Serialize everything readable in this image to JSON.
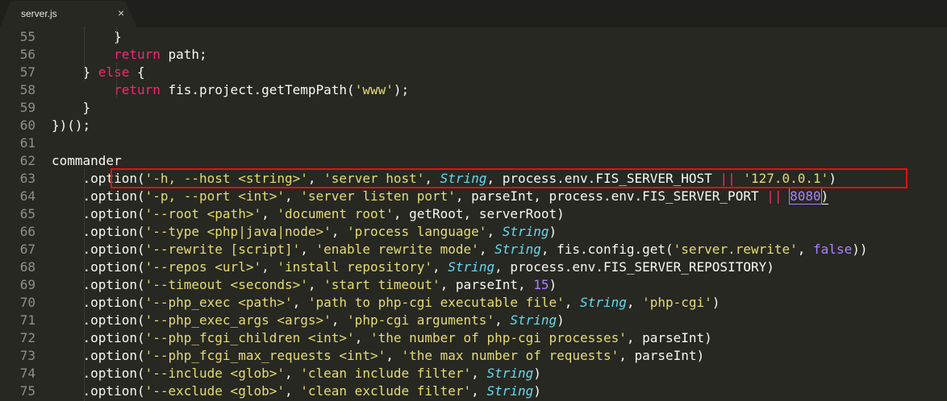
{
  "tab": {
    "filename": "server.js",
    "close_glyph": "×"
  },
  "lines": [
    {
      "no": "55",
      "indent": "        ",
      "tokens": [
        {
          "t": "}",
          "c": ""
        }
      ]
    },
    {
      "no": "56",
      "indent": "        ",
      "tokens": [
        {
          "t": "return",
          "c": "k"
        },
        {
          "t": " path;",
          "c": ""
        }
      ]
    },
    {
      "no": "57",
      "indent": "    ",
      "tokens": [
        {
          "t": "} ",
          "c": ""
        },
        {
          "t": "else",
          "c": "k"
        },
        {
          "t": " {",
          "c": ""
        }
      ]
    },
    {
      "no": "58",
      "indent": "        ",
      "tokens": [
        {
          "t": "return",
          "c": "k"
        },
        {
          "t": " fis.project.getTempPath(",
          "c": ""
        },
        {
          "t": "'www'",
          "c": "s"
        },
        {
          "t": ");",
          "c": ""
        }
      ]
    },
    {
      "no": "59",
      "indent": "    ",
      "tokens": [
        {
          "t": "}",
          "c": ""
        }
      ]
    },
    {
      "no": "60",
      "indent": "",
      "tokens": [
        {
          "t": "})();",
          "c": ""
        }
      ]
    },
    {
      "no": "61",
      "indent": "",
      "tokens": []
    },
    {
      "no": "62",
      "indent": "",
      "tokens": [
        {
          "t": "commander",
          "c": ""
        }
      ]
    },
    {
      "no": "63",
      "indent": "    ",
      "tokens": [
        {
          "t": ".option(",
          "c": ""
        },
        {
          "t": "'-h, --host <string>'",
          "c": "s"
        },
        {
          "t": ", ",
          "c": ""
        },
        {
          "t": "'server host'",
          "c": "s"
        },
        {
          "t": ", ",
          "c": ""
        },
        {
          "t": "String",
          "c": "t"
        },
        {
          "t": ", process.env.FIS_SERVER_HOST ",
          "c": ""
        },
        {
          "t": "||",
          "c": "op"
        },
        {
          "t": " ",
          "c": ""
        },
        {
          "t": "'127.0.0.1'",
          "c": "s"
        },
        {
          "t": ")",
          "c": ""
        }
      ]
    },
    {
      "no": "64",
      "indent": "    ",
      "tokens": [
        {
          "t": ".option(",
          "c": ""
        },
        {
          "t": "'-p, --port <int>'",
          "c": "s"
        },
        {
          "t": ", ",
          "c": ""
        },
        {
          "t": "'server listen port'",
          "c": "s"
        },
        {
          "t": ", parseInt, process.env.FIS_SERVER_PORT ",
          "c": ""
        },
        {
          "t": "||",
          "c": "op"
        },
        {
          "t": " ",
          "c": ""
        },
        {
          "t": "8080",
          "c": "n num-sel"
        },
        {
          "t": ")",
          "c": "paren-match"
        }
      ]
    },
    {
      "no": "65",
      "indent": "    ",
      "tokens": [
        {
          "t": ".option(",
          "c": ""
        },
        {
          "t": "'--root <path>'",
          "c": "s"
        },
        {
          "t": ", ",
          "c": ""
        },
        {
          "t": "'document root'",
          "c": "s"
        },
        {
          "t": ", getRoot, serverRoot)",
          "c": ""
        }
      ]
    },
    {
      "no": "66",
      "indent": "    ",
      "tokens": [
        {
          "t": ".option(",
          "c": ""
        },
        {
          "t": "'--type <php|java|node>'",
          "c": "s"
        },
        {
          "t": ", ",
          "c": ""
        },
        {
          "t": "'process language'",
          "c": "s"
        },
        {
          "t": ", ",
          "c": ""
        },
        {
          "t": "String",
          "c": "t"
        },
        {
          "t": ")",
          "c": ""
        }
      ]
    },
    {
      "no": "67",
      "indent": "    ",
      "tokens": [
        {
          "t": ".option(",
          "c": ""
        },
        {
          "t": "'--rewrite [script]'",
          "c": "s"
        },
        {
          "t": ", ",
          "c": ""
        },
        {
          "t": "'enable rewrite mode'",
          "c": "s"
        },
        {
          "t": ", ",
          "c": ""
        },
        {
          "t": "String",
          "c": "t"
        },
        {
          "t": ", fis.config.get(",
          "c": ""
        },
        {
          "t": "'server.rewrite'",
          "c": "s"
        },
        {
          "t": ", ",
          "c": ""
        },
        {
          "t": "false",
          "c": "n"
        },
        {
          "t": "))",
          "c": ""
        }
      ]
    },
    {
      "no": "68",
      "indent": "    ",
      "tokens": [
        {
          "t": ".option(",
          "c": ""
        },
        {
          "t": "'--repos <url>'",
          "c": "s"
        },
        {
          "t": ", ",
          "c": ""
        },
        {
          "t": "'install repository'",
          "c": "s"
        },
        {
          "t": ", ",
          "c": ""
        },
        {
          "t": "String",
          "c": "t"
        },
        {
          "t": ", process.env.FIS_SERVER_REPOSITORY)",
          "c": ""
        }
      ]
    },
    {
      "no": "69",
      "indent": "    ",
      "tokens": [
        {
          "t": ".option(",
          "c": ""
        },
        {
          "t": "'--timeout <seconds>'",
          "c": "s"
        },
        {
          "t": ", ",
          "c": ""
        },
        {
          "t": "'start timeout'",
          "c": "s"
        },
        {
          "t": ", parseInt, ",
          "c": ""
        },
        {
          "t": "15",
          "c": "n"
        },
        {
          "t": ")",
          "c": ""
        }
      ]
    },
    {
      "no": "70",
      "indent": "    ",
      "tokens": [
        {
          "t": ".option(",
          "c": ""
        },
        {
          "t": "'--php_exec <path>'",
          "c": "s"
        },
        {
          "t": ", ",
          "c": ""
        },
        {
          "t": "'path to php-cgi executable file'",
          "c": "s"
        },
        {
          "t": ", ",
          "c": ""
        },
        {
          "t": "String",
          "c": "t"
        },
        {
          "t": ", ",
          "c": ""
        },
        {
          "t": "'php-cgi'",
          "c": "s"
        },
        {
          "t": ")",
          "c": ""
        }
      ]
    },
    {
      "no": "71",
      "indent": "    ",
      "tokens": [
        {
          "t": ".option(",
          "c": ""
        },
        {
          "t": "'--php_exec_args <args>'",
          "c": "s"
        },
        {
          "t": ", ",
          "c": ""
        },
        {
          "t": "'php-cgi arguments'",
          "c": "s"
        },
        {
          "t": ", ",
          "c": ""
        },
        {
          "t": "String",
          "c": "t"
        },
        {
          "t": ")",
          "c": ""
        }
      ]
    },
    {
      "no": "72",
      "indent": "    ",
      "tokens": [
        {
          "t": ".option(",
          "c": ""
        },
        {
          "t": "'--php_fcgi_children <int>'",
          "c": "s"
        },
        {
          "t": ", ",
          "c": ""
        },
        {
          "t": "'the number of php-cgi processes'",
          "c": "s"
        },
        {
          "t": ", parseInt)",
          "c": ""
        }
      ]
    },
    {
      "no": "73",
      "indent": "    ",
      "tokens": [
        {
          "t": ".option(",
          "c": ""
        },
        {
          "t": "'--php_fcgi_max_requests <int>'",
          "c": "s"
        },
        {
          "t": ", ",
          "c": ""
        },
        {
          "t": "'the max number of requests'",
          "c": "s"
        },
        {
          "t": ", parseInt)",
          "c": ""
        }
      ]
    },
    {
      "no": "74",
      "indent": "    ",
      "tokens": [
        {
          "t": ".option(",
          "c": ""
        },
        {
          "t": "'--include <glob>'",
          "c": "s"
        },
        {
          "t": ", ",
          "c": ""
        },
        {
          "t": "'clean include filter'",
          "c": "s"
        },
        {
          "t": ", ",
          "c": ""
        },
        {
          "t": "String",
          "c": "t"
        },
        {
          "t": ")",
          "c": ""
        }
      ]
    },
    {
      "no": "75",
      "indent": "    ",
      "tokens": [
        {
          "t": ".option(",
          "c": ""
        },
        {
          "t": "'--exclude <glob>'",
          "c": "s"
        },
        {
          "t": ", ",
          "c": ""
        },
        {
          "t": "'clean exclude filter'",
          "c": "s"
        },
        {
          "t": ", ",
          "c": ""
        },
        {
          "t": "String",
          "c": "t"
        },
        {
          "t": ")",
          "c": ""
        }
      ]
    }
  ]
}
